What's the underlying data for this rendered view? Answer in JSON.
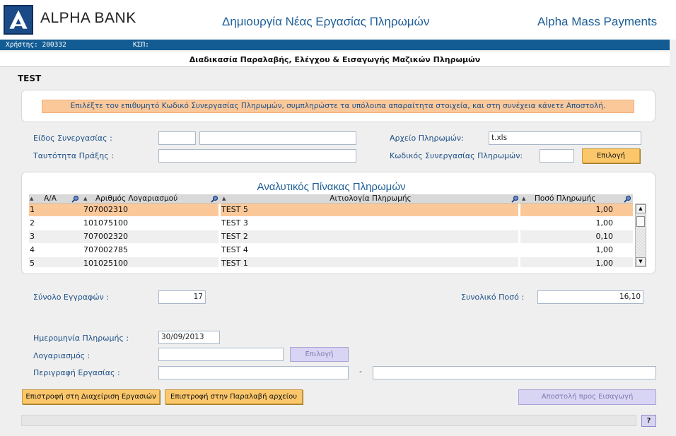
{
  "header": {
    "bank_name": "ALPHA BANK",
    "page_heading": "Δημιουργία Νέας Εργασίας Πληρωμών",
    "app_name": "Alpha Mass Payments"
  },
  "user_bar": {
    "user_label": "Χρήστης: 200332",
    "ksp_label": "ΚΣΠ:"
  },
  "process_title": "Διαδικασία Παραλαβής, Ελέγχου & Εισαγωγής Μαζικών Πληρωμών",
  "section_label": "TEST",
  "info_message": "Επιλέξτε τον επιθυμητό Κωδικό Συνεργασίας Πληρωμών, συμπληρώστε τα υπόλοιπα απαραίτητα στοιχεία, και στη συνέχεια κάνετε Αποστολή.",
  "form": {
    "cooperation_type_label": "Είδος Συνεργασίας :",
    "cooperation_type_code": "",
    "cooperation_type_desc": "",
    "transaction_id_label": "Ταυτότητα Πράξης :",
    "transaction_id_value": "",
    "payments_file_label": "Αρχείο Πληρωμών:",
    "payments_file_value": "t.xls",
    "coop_code_label": "Κωδικός Συνεργασίας Πληρωμών:",
    "coop_code_value": "",
    "select_button": "Επιλογή"
  },
  "table": {
    "title": "Αναλυτικός Πίνακας Πληρωμών",
    "columns": [
      "Α/Α",
      "Αριθμός Λογαριασμού",
      "Αιτιολογία Πληρωμής",
      "Ποσό Πληρωμής"
    ],
    "rows": [
      {
        "aa": "1",
        "account": "707002310",
        "reason": "TEST 5",
        "amount": "1,00"
      },
      {
        "aa": "2",
        "account": "101075100",
        "reason": "TEST 3",
        "amount": "1,00"
      },
      {
        "aa": "3",
        "account": "707002320",
        "reason": "TEST 2",
        "amount": "0,10"
      },
      {
        "aa": "4",
        "account": "707002785",
        "reason": "TEST 4",
        "amount": "1,00"
      },
      {
        "aa": "5",
        "account": "101025100",
        "reason": "TEST 1",
        "amount": "1,00"
      }
    ]
  },
  "totals": {
    "records_label": "Σύνολο Εγγραφών :",
    "records_value": "17",
    "amount_label": "Συνολικό Ποσό :",
    "amount_value": "16,10"
  },
  "payment": {
    "date_label": "Ημερομηνία Πληρωμής :",
    "date_value": "30/09/2013",
    "account_label": "Λογαριασμός :",
    "account_value": "",
    "account_select_button": "Επιλογή",
    "description_label": "Περιγραφή Εργασίας :",
    "description_part1": "",
    "dash": "-",
    "description_part2": ""
  },
  "actions": {
    "back_to_jobs": "Επιστροφή στη Διαχείριση Εργασιών",
    "back_to_file": "Επιστροφή στην Παραλαβή αρχείου",
    "send": "Αποστολή προς Εισαγωγή",
    "help": "?"
  },
  "colors": {
    "accent_blue": "#135c93",
    "highlight_orange": "#fbc89a",
    "button_orange": "#fbc76a",
    "disabled_lavender": "#d8d4f3"
  }
}
